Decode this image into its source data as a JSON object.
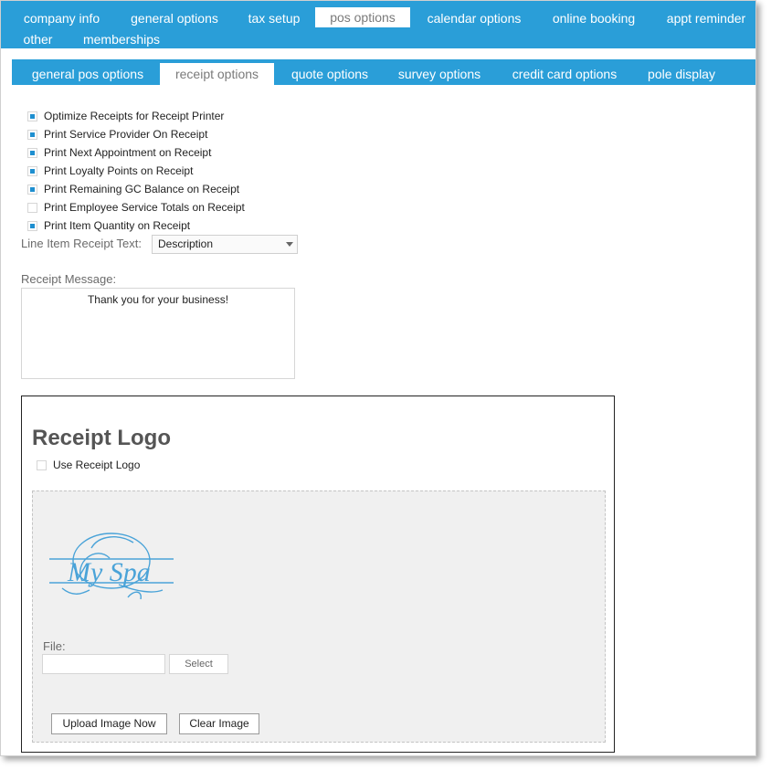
{
  "top_nav": {
    "tabs": [
      {
        "label": "company info"
      },
      {
        "label": "general options"
      },
      {
        "label": "tax setup"
      },
      {
        "label": "pos options",
        "active": true
      },
      {
        "label": "calendar options"
      },
      {
        "label": "online booking"
      },
      {
        "label": "appt reminder"
      },
      {
        "label": "other"
      },
      {
        "label": "memberships"
      }
    ]
  },
  "sub_nav": {
    "tabs": [
      {
        "label": "general pos options"
      },
      {
        "label": "receipt options",
        "active": true
      },
      {
        "label": "quote options"
      },
      {
        "label": "survey options"
      },
      {
        "label": "credit card options"
      },
      {
        "label": "pole display"
      }
    ]
  },
  "receipt_options": {
    "checkboxes": [
      {
        "label": "Optimize Receipts for Receipt Printer",
        "checked": true
      },
      {
        "label": "Print Service Provider On Receipt",
        "checked": true
      },
      {
        "label": "Print Next Appointment on Receipt",
        "checked": true
      },
      {
        "label": "Print Loyalty Points on Receipt",
        "checked": true
      },
      {
        "label": "Print Remaining GC Balance on Receipt",
        "checked": true
      },
      {
        "label": "Print Employee Service Totals on Receipt",
        "checked": false
      },
      {
        "label": "Print Item Quantity on Receipt",
        "checked": true
      }
    ],
    "line_item_label": "Line Item Receipt Text:",
    "line_item_value": "Description",
    "message_label": "Receipt Message:",
    "message_value": "Thank you for your business!"
  },
  "receipt_logo": {
    "title": "Receipt Logo",
    "use_logo_label": "Use Receipt Logo",
    "use_logo_checked": false,
    "logo_text": "My Spa",
    "file_label": "File:",
    "select_label": "Select",
    "upload_label": "Upload Image Now",
    "clear_label": "Clear Image"
  },
  "colors": {
    "accent": "#2a9ed8",
    "logo": "#4aa3d8"
  }
}
